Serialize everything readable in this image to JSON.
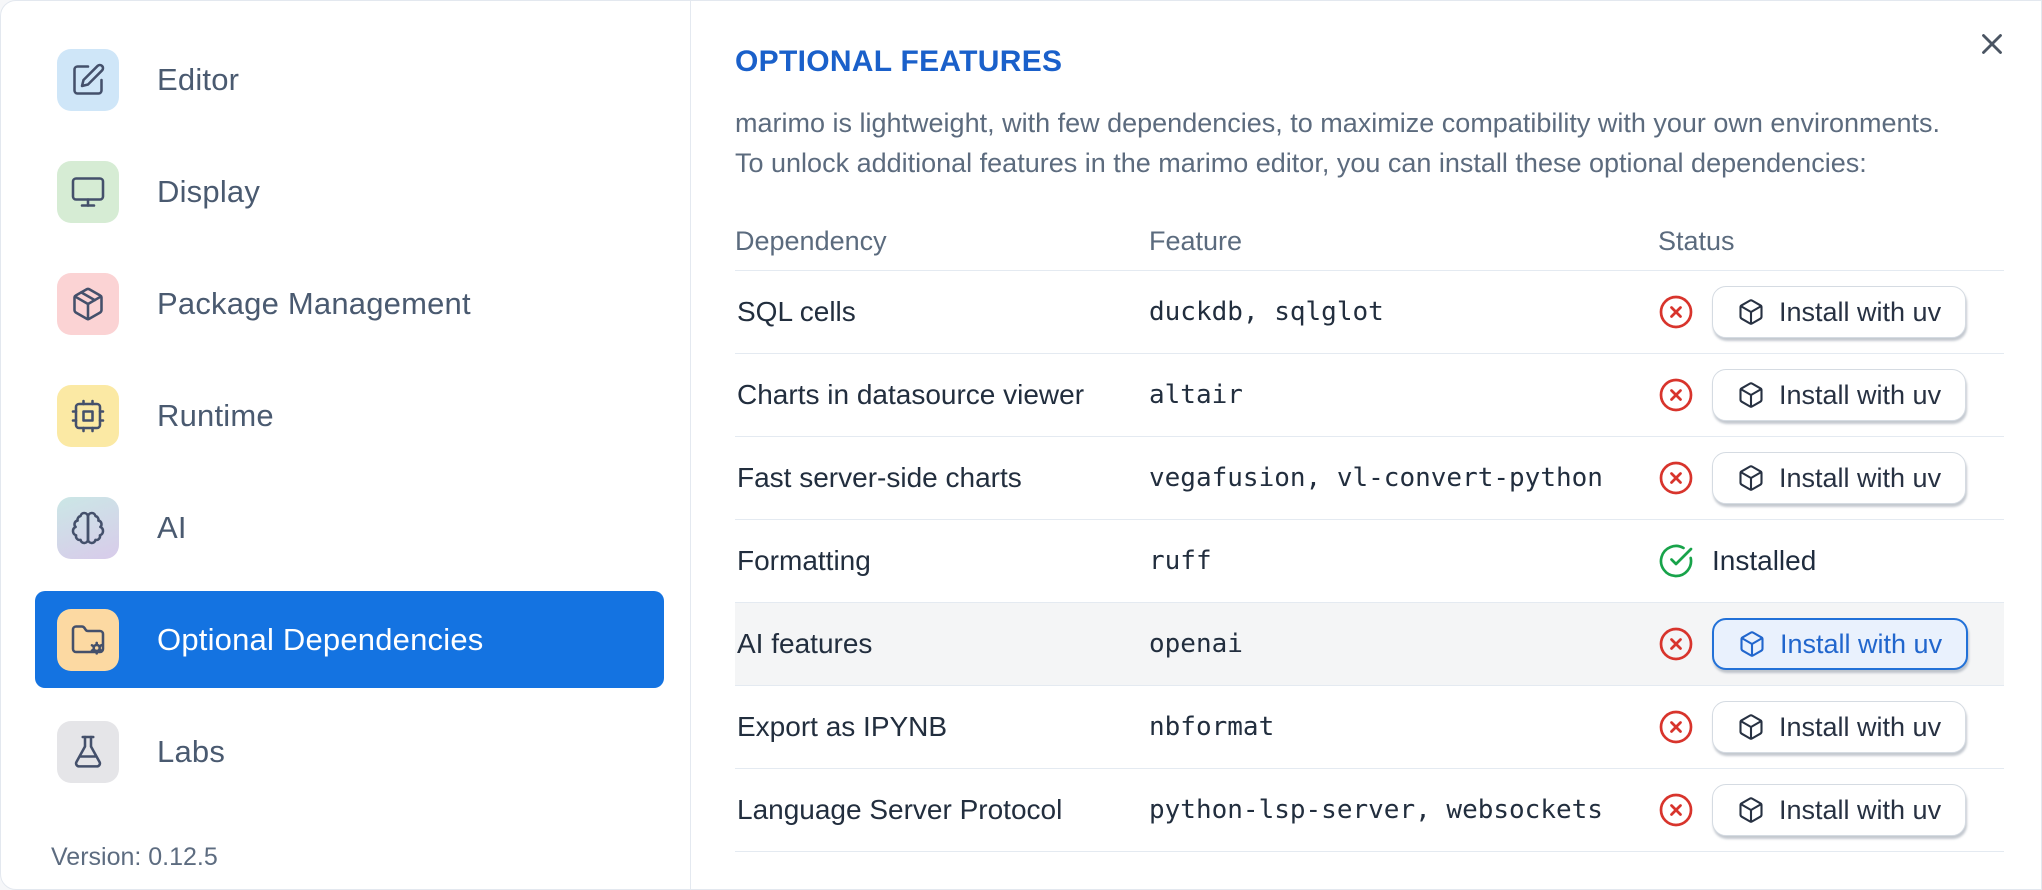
{
  "sidebar": {
    "items": [
      {
        "label": "Editor",
        "icon": "pencil-square-icon",
        "tile_color": "#cfe6f8",
        "selected": false
      },
      {
        "label": "Display",
        "icon": "monitor-icon",
        "tile_color": "#d6ecd4",
        "selected": false
      },
      {
        "label": "Package Management",
        "icon": "package-icon",
        "tile_color": "#fbd3d4",
        "selected": false
      },
      {
        "label": "Runtime",
        "icon": "cpu-icon",
        "tile_color": "#fbe9a4",
        "selected": false
      },
      {
        "label": "AI",
        "icon": "brain-icon",
        "tile_color": "linear-gradient(160deg,#cbe7e6,#d8cbea)",
        "selected": false
      },
      {
        "label": "Optional Dependencies",
        "icon": "folder-cog-icon",
        "tile_color": "#fcd9a2",
        "selected": true
      },
      {
        "label": "Labs",
        "icon": "flask-icon",
        "tile_color": "#e5e5e8",
        "selected": false
      }
    ],
    "selected_color": "#1473e1",
    "version_label": "Version: 0.12.5"
  },
  "panel": {
    "title": "OPTIONAL FEATURES",
    "description_line1": "marimo is lightweight, with few dependencies, to maximize compatibility with your own environments.",
    "description_line2": "To unlock additional features in the marimo editor, you can install these optional dependencies:",
    "table": {
      "headers": {
        "dependency": "Dependency",
        "feature": "Feature",
        "status": "Status"
      },
      "install_button_label": "Install with uv",
      "installed_label": "Installed",
      "rows": [
        {
          "dependency": "SQL cells",
          "feature": "duckdb, sqlglot",
          "installed": false,
          "highlighted": false
        },
        {
          "dependency": "Charts in datasource viewer",
          "feature": "altair",
          "installed": false,
          "highlighted": false
        },
        {
          "dependency": "Fast server-side charts",
          "feature": "vegafusion, vl-convert-python",
          "installed": false,
          "highlighted": false
        },
        {
          "dependency": "Formatting",
          "feature": "ruff",
          "installed": true,
          "highlighted": false
        },
        {
          "dependency": "AI features",
          "feature": "openai",
          "installed": false,
          "highlighted": true
        },
        {
          "dependency": "Export as IPYNB",
          "feature": "nbformat",
          "installed": false,
          "highlighted": false
        },
        {
          "dependency": "Language Server Protocol",
          "feature": "python-lsp-server, websockets",
          "installed": false,
          "highlighted": false
        }
      ]
    }
  },
  "colors": {
    "selected_blue": "#1473e1",
    "title_blue": "#1a60ca",
    "missing_red": "#d8342c",
    "installed_green": "#18a34a",
    "row_border": "#e4eaf1",
    "highlight_row_bg": "#f4f5f6",
    "highlight_btn_border": "#2271d8",
    "highlight_btn_bg": "#e9f1fd"
  }
}
